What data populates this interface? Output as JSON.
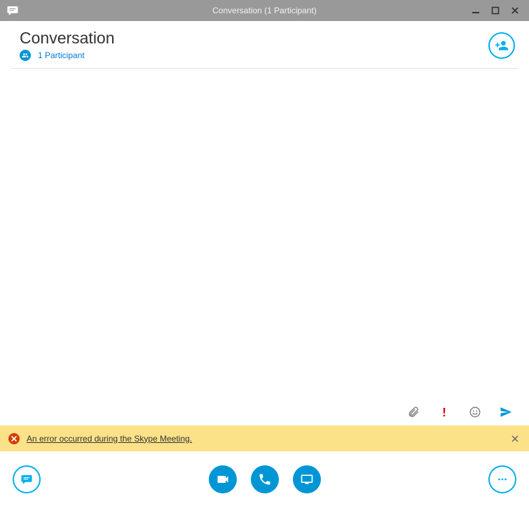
{
  "window": {
    "title": "Conversation (1 Participant)"
  },
  "header": {
    "title": "Conversation",
    "participant_text": "1 Participant"
  },
  "error": {
    "message": "An error occurred during the Skype Meeting."
  }
}
